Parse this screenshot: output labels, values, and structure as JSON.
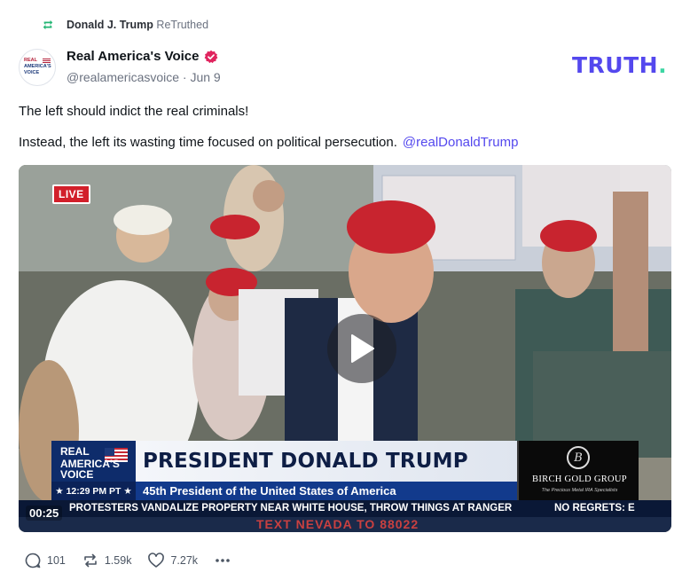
{
  "retruth": {
    "name": "Donald J. Trump",
    "verb": "ReTruthed"
  },
  "author": {
    "display_name": "Real America's Voice",
    "meta": "@realamericasvoice · Jun 9",
    "avatar_text": [
      "REAL",
      "AMERICA'S",
      "VOICE"
    ]
  },
  "brand": {
    "logo": "TRUTH",
    "logo_dot": "."
  },
  "post": {
    "line1": "The left should indict the real criminals!",
    "line2": "Instead, the left its wasting time focused on political persecution.",
    "mention": "@realDonaldTrump"
  },
  "video": {
    "live_label": "LIVE",
    "timestamp": "00:25",
    "chyron": {
      "logo_lines": [
        "REAL",
        "AMERICA'S",
        "VOICE"
      ],
      "time": "★ 12:29 PM PT ★",
      "headline": "PRESIDENT DONALD TRUMP",
      "subheadline": "45th President of the United States of America",
      "sponsor_name": "BIRCH GOLD GROUP",
      "sponsor_tagline": "The Precious Metal IRA Specialists",
      "sponsor_initial": "B"
    },
    "ticker": "PROTESTERS VANDALIZE PROPERTY NEAR WHITE HOUSE, THROW THINGS AT RANGER",
    "ticker_right": "NO REGRETS: E",
    "bottom_text": "TEXT NEVADA TO 88022"
  },
  "actions": {
    "replies": "101",
    "retruths": "1.59k",
    "likes": "7.27k"
  },
  "colors": {
    "accent": "#5448ee",
    "verified": "#e0245e",
    "live": "#d21f2a"
  }
}
